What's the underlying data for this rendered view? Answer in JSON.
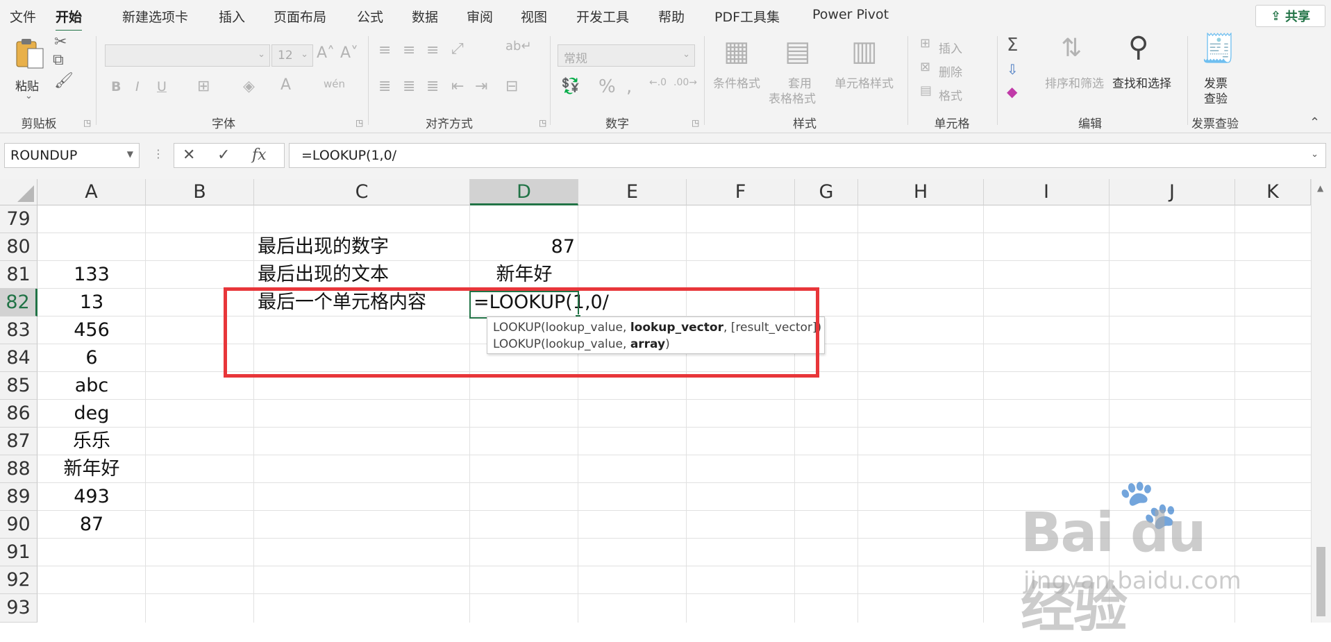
{
  "menu": {
    "tabs": [
      {
        "label": "文件"
      },
      {
        "label": "开始"
      },
      {
        "label": "新建选项卡"
      },
      {
        "label": "插入"
      },
      {
        "label": "页面布局"
      },
      {
        "label": "公式"
      },
      {
        "label": "数据"
      },
      {
        "label": "审阅"
      },
      {
        "label": "视图"
      },
      {
        "label": "开发工具"
      },
      {
        "label": "帮助"
      },
      {
        "label": "PDF工具集"
      },
      {
        "label": "Power Pivot"
      }
    ],
    "share_label": "共享"
  },
  "ribbon": {
    "clipboard": {
      "group": "剪贴板",
      "paste": "粘贴"
    },
    "font": {
      "group": "字体",
      "bold": "B",
      "italic": "I",
      "underline": "U",
      "size": "12"
    },
    "alignment": {
      "group": "对齐方式"
    },
    "number": {
      "group": "数字",
      "format": "常规"
    },
    "styles": {
      "group": "样式",
      "conditional": "条件格式",
      "table_1": "套用",
      "table_2": "表格格式",
      "cell_styles": "单元格样式"
    },
    "cells": {
      "group": "单元格",
      "insert": "插入",
      "delete": "删除",
      "format": "格式"
    },
    "editing": {
      "group": "编辑",
      "sort": "排序和筛选",
      "find": "查找和选择"
    },
    "invoice": {
      "group": "发票查验",
      "btn_1": "发票",
      "btn_2": "查验"
    }
  },
  "formula_bar": {
    "name_box": "ROUNDUP",
    "formula": "=LOOKUP(1,0/"
  },
  "columns": [
    "A",
    "B",
    "C",
    "D",
    "E",
    "F",
    "G",
    "H",
    "I",
    "J",
    "K"
  ],
  "selected_column": "D",
  "rows": [
    "79",
    "80",
    "81",
    "82",
    "83",
    "84",
    "85",
    "86",
    "87",
    "88",
    "89",
    "90",
    "91",
    "92",
    "93"
  ],
  "selected_row": "82",
  "cells": {
    "A81": "133",
    "A82": "13",
    "A83": "456",
    "A84": "6",
    "A85": "abc",
    "A86": "deg",
    "A87": "乐乐",
    "A88": "新年好",
    "A89": "493",
    "A90": "87",
    "C80": "最后出现的数字",
    "C81": "最后出现的文本",
    "C82": "最后一个单元格内容",
    "D80": "87",
    "D81": "新年好",
    "D82": "=LOOKUP(1,0/"
  },
  "tooltip": {
    "line1_a": "LOOKUP(lookup_value, ",
    "line1_b": "lookup_vector",
    "line1_c": ", [result_vector])",
    "line2_a": "LOOKUP(lookup_value, ",
    "line2_b": "array",
    "line2_c": ")"
  },
  "watermark": {
    "brand": "Bai du 经验",
    "url": "jingyan.baidu.com"
  },
  "colors": {
    "excel_green": "#217346",
    "highlight_red": "#e8363a"
  }
}
